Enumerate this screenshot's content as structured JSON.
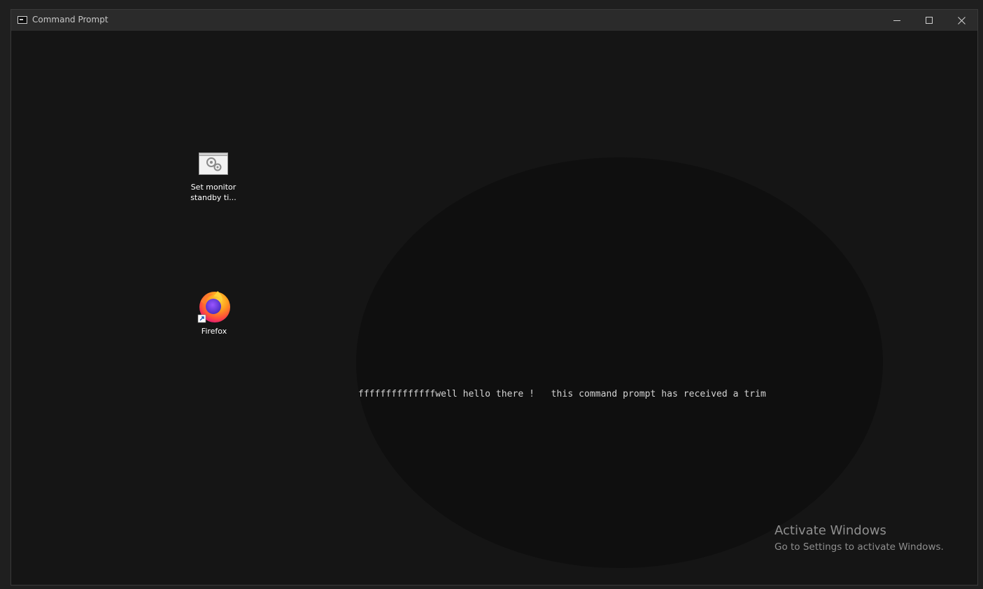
{
  "window": {
    "title": "Command Prompt",
    "icon": "cmd-icon",
    "controls": [
      "minimize-icon",
      "maximize-icon",
      "close-icon"
    ]
  },
  "desktop_icons": [
    {
      "label_line1": "Set monitor",
      "label_line2": "standby ti...",
      "icon": "settings-shortcut-icon"
    },
    {
      "label": "Firefox",
      "icon": "firefox-icon"
    }
  ],
  "console": {
    "line": "ffffffffffffffwell hello there !   this command prompt has received a trim"
  },
  "watermark": {
    "title": "Activate Windows",
    "subtitle": "Go to Settings to activate Windows."
  }
}
